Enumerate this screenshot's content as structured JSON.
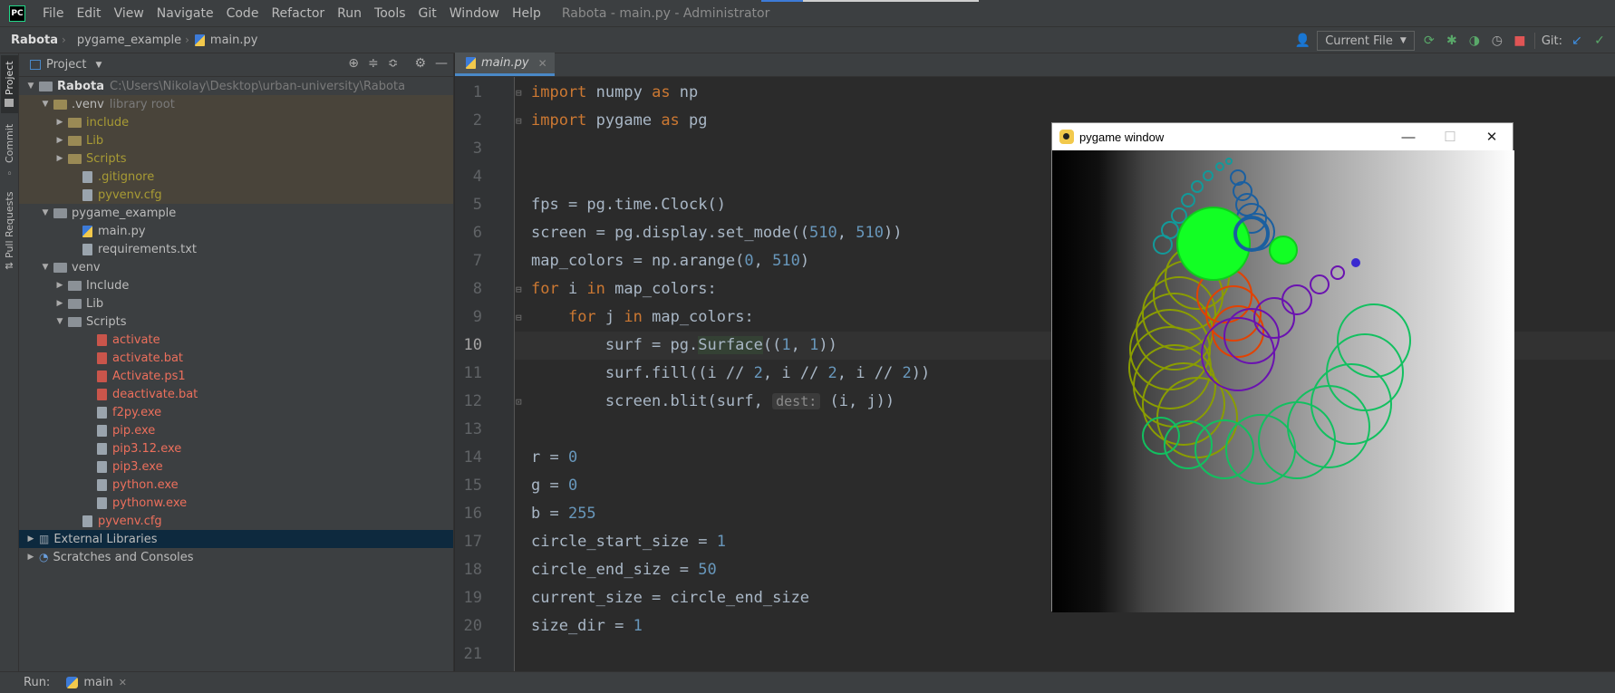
{
  "menubar": {
    "app_badge": "PC",
    "items": [
      "File",
      "Edit",
      "View",
      "Navigate",
      "Code",
      "Refactor",
      "Run",
      "Tools",
      "Git",
      "Window",
      "Help"
    ],
    "window_title": "Rabota - main.py - Administrator"
  },
  "navbar": {
    "breadcrumbs": [
      "Rabota",
      "pygame_example",
      "main.py"
    ],
    "run_config": "Current File",
    "git_label": "Git:"
  },
  "left_strip": {
    "tabs": [
      "Project",
      "Commit",
      "Pull Requests"
    ]
  },
  "project_panel": {
    "title": "Project",
    "root_name": "Rabota",
    "root_path": "C:\\Users\\Nikolay\\Desktop\\urban-university\\Rabota",
    "venv_dot": ".venv",
    "library_root": "library root",
    "items": {
      "include": "include",
      "lib": "Lib",
      "scripts": "Scripts",
      "gitignore": ".gitignore",
      "pyvenv_cfg": "pyvenv.cfg",
      "pygame_example": "pygame_example",
      "main_py": "main.py",
      "requirements": "requirements.txt",
      "venv": "venv",
      "venv_include": "Include",
      "venv_lib": "Lib",
      "venv_scripts": "Scripts",
      "activate": "activate",
      "activate_bat": "activate.bat",
      "activate_ps1": "Activate.ps1",
      "deactivate_bat": "deactivate.bat",
      "f2py": "f2py.exe",
      "pip": "pip.exe",
      "pip312": "pip3.12.exe",
      "pip3": "pip3.exe",
      "python": "python.exe",
      "pythonw": "pythonw.exe",
      "venv_pyvenv_cfg": "pyvenv.cfg",
      "external_libraries": "External Libraries",
      "scratches": "Scratches and Consoles"
    }
  },
  "editor": {
    "tab_name": "main.py",
    "line_numbers": [
      "1",
      "2",
      "3",
      "4",
      "5",
      "6",
      "7",
      "8",
      "9",
      "10",
      "11",
      "12",
      "13",
      "14",
      "15",
      "16",
      "17",
      "18",
      "19",
      "20",
      "21"
    ],
    "current_line": "10",
    "lines": {
      "l1_kw": "import",
      "l1_rest": " numpy ",
      "l1_as": "as",
      "l1_alias": " np",
      "l2_kw": "import",
      "l2_rest": " pygame ",
      "l2_as": "as",
      "l2_alias": " pg",
      "l5": "fps = pg.time.Clock()",
      "l6_a": "screen = pg.display.set_mode((",
      "l6_n1": "510",
      "l6_c": ", ",
      "l6_n2": "510",
      "l6_b": "))",
      "l7_a": "map_colors = np.arange(",
      "l7_n1": "0",
      "l7_c": ", ",
      "l7_n2": "510",
      "l7_b": ")",
      "l8_for": "for",
      "l8_a": " i ",
      "l8_in": "in",
      "l8_b": " map_colors:",
      "l9_indent": "    ",
      "l9_for": "for",
      "l9_a": " j ",
      "l9_in": "in",
      "l9_b": " map_colors:",
      "l10_a": "        surf = pg.",
      "l10_hl": "Surface",
      "l10_b": "((",
      "l10_n1": "1",
      "l10_c": ", ",
      "l10_n2": "1",
      "l10_d": "))",
      "l11_a": "        surf.fill((i // ",
      "l11_n1": "2",
      "l11_b": ", i // ",
      "l11_n2": "2",
      "l11_c": ", i // ",
      "l11_n3": "2",
      "l11_d": "))",
      "l12_a": "        screen.blit(surf, ",
      "l12_hint": "dest:",
      "l12_b": " (i, j))",
      "l14_a": "r = ",
      "l14_n": "0",
      "l15_a": "g = ",
      "l15_n": "0",
      "l16_a": "b = ",
      "l16_n": "255",
      "l17_a": "circle_start_size = ",
      "l17_n": "1",
      "l18_a": "circle_end_size = ",
      "l18_n": "50",
      "l19": "current_size = circle_end_size",
      "l20_a": "size_dir = ",
      "l20_n": "1"
    }
  },
  "pygame_window": {
    "title": "pygame window",
    "minimize": "—",
    "maximize": "☐",
    "close": "✕"
  },
  "statusbar": {
    "run_label": "Run:",
    "run_tab": "main"
  },
  "colors": {
    "keyword": "#cc7832",
    "number": "#6897bb",
    "text": "#a9b7c6",
    "library_bg": "#49443a",
    "selected_bg": "#0d293e"
  }
}
